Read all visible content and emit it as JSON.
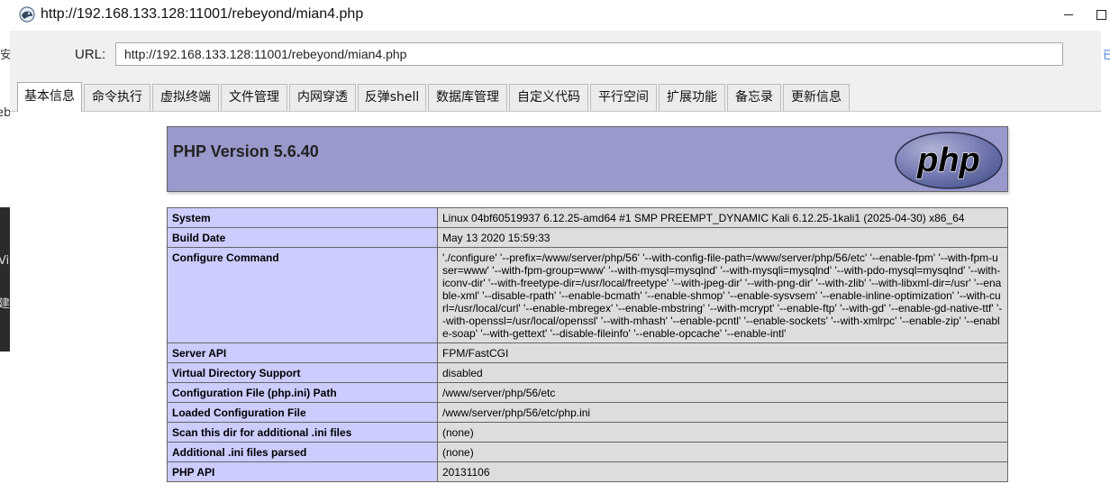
{
  "window": {
    "title": "http://192.168.133.128:11001/rebeyond/mian4.php",
    "icon": "behinder-app-icon"
  },
  "background_window": {
    "fragments": [
      "安",
      "eb",
      "Vi",
      "建"
    ]
  },
  "right_fragment": "已",
  "urlbar": {
    "label": "URL:",
    "value": "http://192.168.133.128:11001/rebeyond/mian4.php"
  },
  "tabs": [
    {
      "label": "基本信息",
      "active": true
    },
    {
      "label": "命令执行",
      "active": false
    },
    {
      "label": "虚拟终端",
      "active": false
    },
    {
      "label": "文件管理",
      "active": false
    },
    {
      "label": "内网穿透",
      "active": false
    },
    {
      "label": "反弹shell",
      "active": false
    },
    {
      "label": "数据库管理",
      "active": false
    },
    {
      "label": "自定义代码",
      "active": false
    },
    {
      "label": "平行空间",
      "active": false
    },
    {
      "label": "扩展功能",
      "active": false
    },
    {
      "label": "备忘录",
      "active": false
    },
    {
      "label": "更新信息",
      "active": false
    }
  ],
  "phpinfo": {
    "version_title": "PHP Version 5.6.40",
    "logo_text": "php",
    "colors": {
      "header": "#9999cc",
      "key": "#ccccff",
      "value": "#dddddd"
    },
    "rows": [
      {
        "key": "System",
        "value": "Linux 04bf60519937 6.12.25-amd64 #1 SMP PREEMPT_DYNAMIC Kali 6.12.25-1kali1 (2025-04-30) x86_64"
      },
      {
        "key": "Build Date",
        "value": "May 13 2020 15:59:33"
      },
      {
        "key": "Configure Command",
        "value": "'./configure' '--prefix=/www/server/php/56' '--with-config-file-path=/www/server/php/56/etc' '--enable-fpm' '--with-fpm-user=www' '--with-fpm-group=www' '--with-mysql=mysqlnd' '--with-mysqli=mysqlnd' '--with-pdo-mysql=mysqlnd' '--with-iconv-dir' '--with-freetype-dir=/usr/local/freetype' '--with-jpeg-dir' '--with-png-dir' '--with-zlib' '--with-libxml-dir=/usr' '--enable-xml' '--disable-rpath' '--enable-bcmath' '--enable-shmop' '--enable-sysvsem' '--enable-inline-optimization' '--with-curl=/usr/local/curl' '--enable-mbregex' '--enable-mbstring' '--with-mcrypt' '--enable-ftp' '--with-gd' '--enable-gd-native-ttf' '--with-openssl=/usr/local/openssl' '--with-mhash' '--enable-pcntl' '--enable-sockets' '--with-xmlrpc' '--enable-zip' '--enable-soap' '--with-gettext' '--disable-fileinfo' '--enable-opcache' '--enable-intl'"
      },
      {
        "key": "Server API",
        "value": "FPM/FastCGI"
      },
      {
        "key": "Virtual Directory Support",
        "value": "disabled"
      },
      {
        "key": "Configuration File (php.ini) Path",
        "value": "/www/server/php/56/etc"
      },
      {
        "key": "Loaded Configuration File",
        "value": "/www/server/php/56/etc/php.ini"
      },
      {
        "key": "Scan this dir for additional .ini files",
        "value": "(none)"
      },
      {
        "key": "Additional .ini files parsed",
        "value": "(none)"
      },
      {
        "key": "PHP API",
        "value": "20131106"
      }
    ]
  }
}
